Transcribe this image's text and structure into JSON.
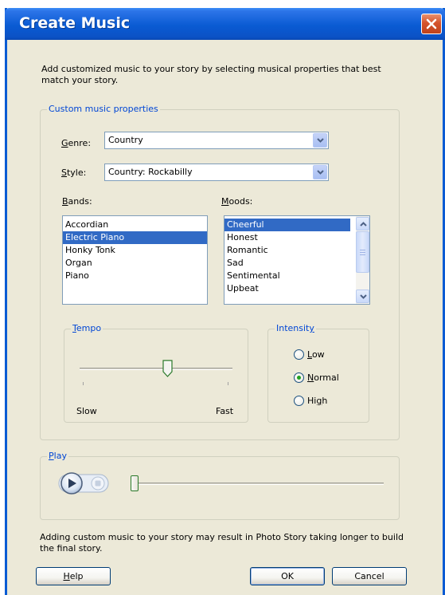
{
  "title": "Create Music",
  "intro": "Add customized music to your story by selecting musical properties that best match your story.",
  "custom": {
    "group_label": "Custom music properties",
    "genre": {
      "label_access": "G",
      "label_rest": "enre:",
      "value": "Country"
    },
    "style": {
      "label_access": "S",
      "label_rest": "tyle:",
      "value": "Country: Rockabilly"
    },
    "bands": {
      "label_access": "B",
      "label_rest": "ands:",
      "items": [
        "Accordian",
        "Electric Piano",
        "Honky Tonk",
        "Organ",
        "Piano"
      ],
      "selected": "Electric Piano"
    },
    "moods": {
      "label_access": "M",
      "label_rest": "oods:",
      "items": [
        "Cheerful",
        "Honest",
        "Romantic",
        "Sad",
        "Sentimental",
        "Upbeat"
      ],
      "selected": "Cheerful"
    },
    "tempo": {
      "label_access": "T",
      "label_rest": "empo",
      "min_label": "Slow",
      "max_label": "Fast",
      "value_fraction": 0.58
    },
    "intensity": {
      "label_pre": "Intensit",
      "label_access": "y",
      "options": [
        {
          "pre": "",
          "access": "L",
          "post": "ow"
        },
        {
          "pre": "",
          "access": "N",
          "post": "ormal"
        },
        {
          "pre": "Hi",
          "access": "g",
          "post": "h"
        }
      ],
      "selected_index": 1
    }
  },
  "play": {
    "label_access": "P",
    "label_rest": "lay",
    "position_fraction": 0.0
  },
  "footer_note": "Adding custom music to your story may result in Photo Story taking longer to build the final story.",
  "buttons": {
    "help": {
      "access": "H",
      "rest": "elp"
    },
    "ok": "OK",
    "cancel": "Cancel"
  },
  "colors": {
    "titlebar": "#0A5BD3",
    "dialog_bg": "#ECE9D8",
    "group_title": "#0046D5",
    "selection": "#316AC5"
  }
}
